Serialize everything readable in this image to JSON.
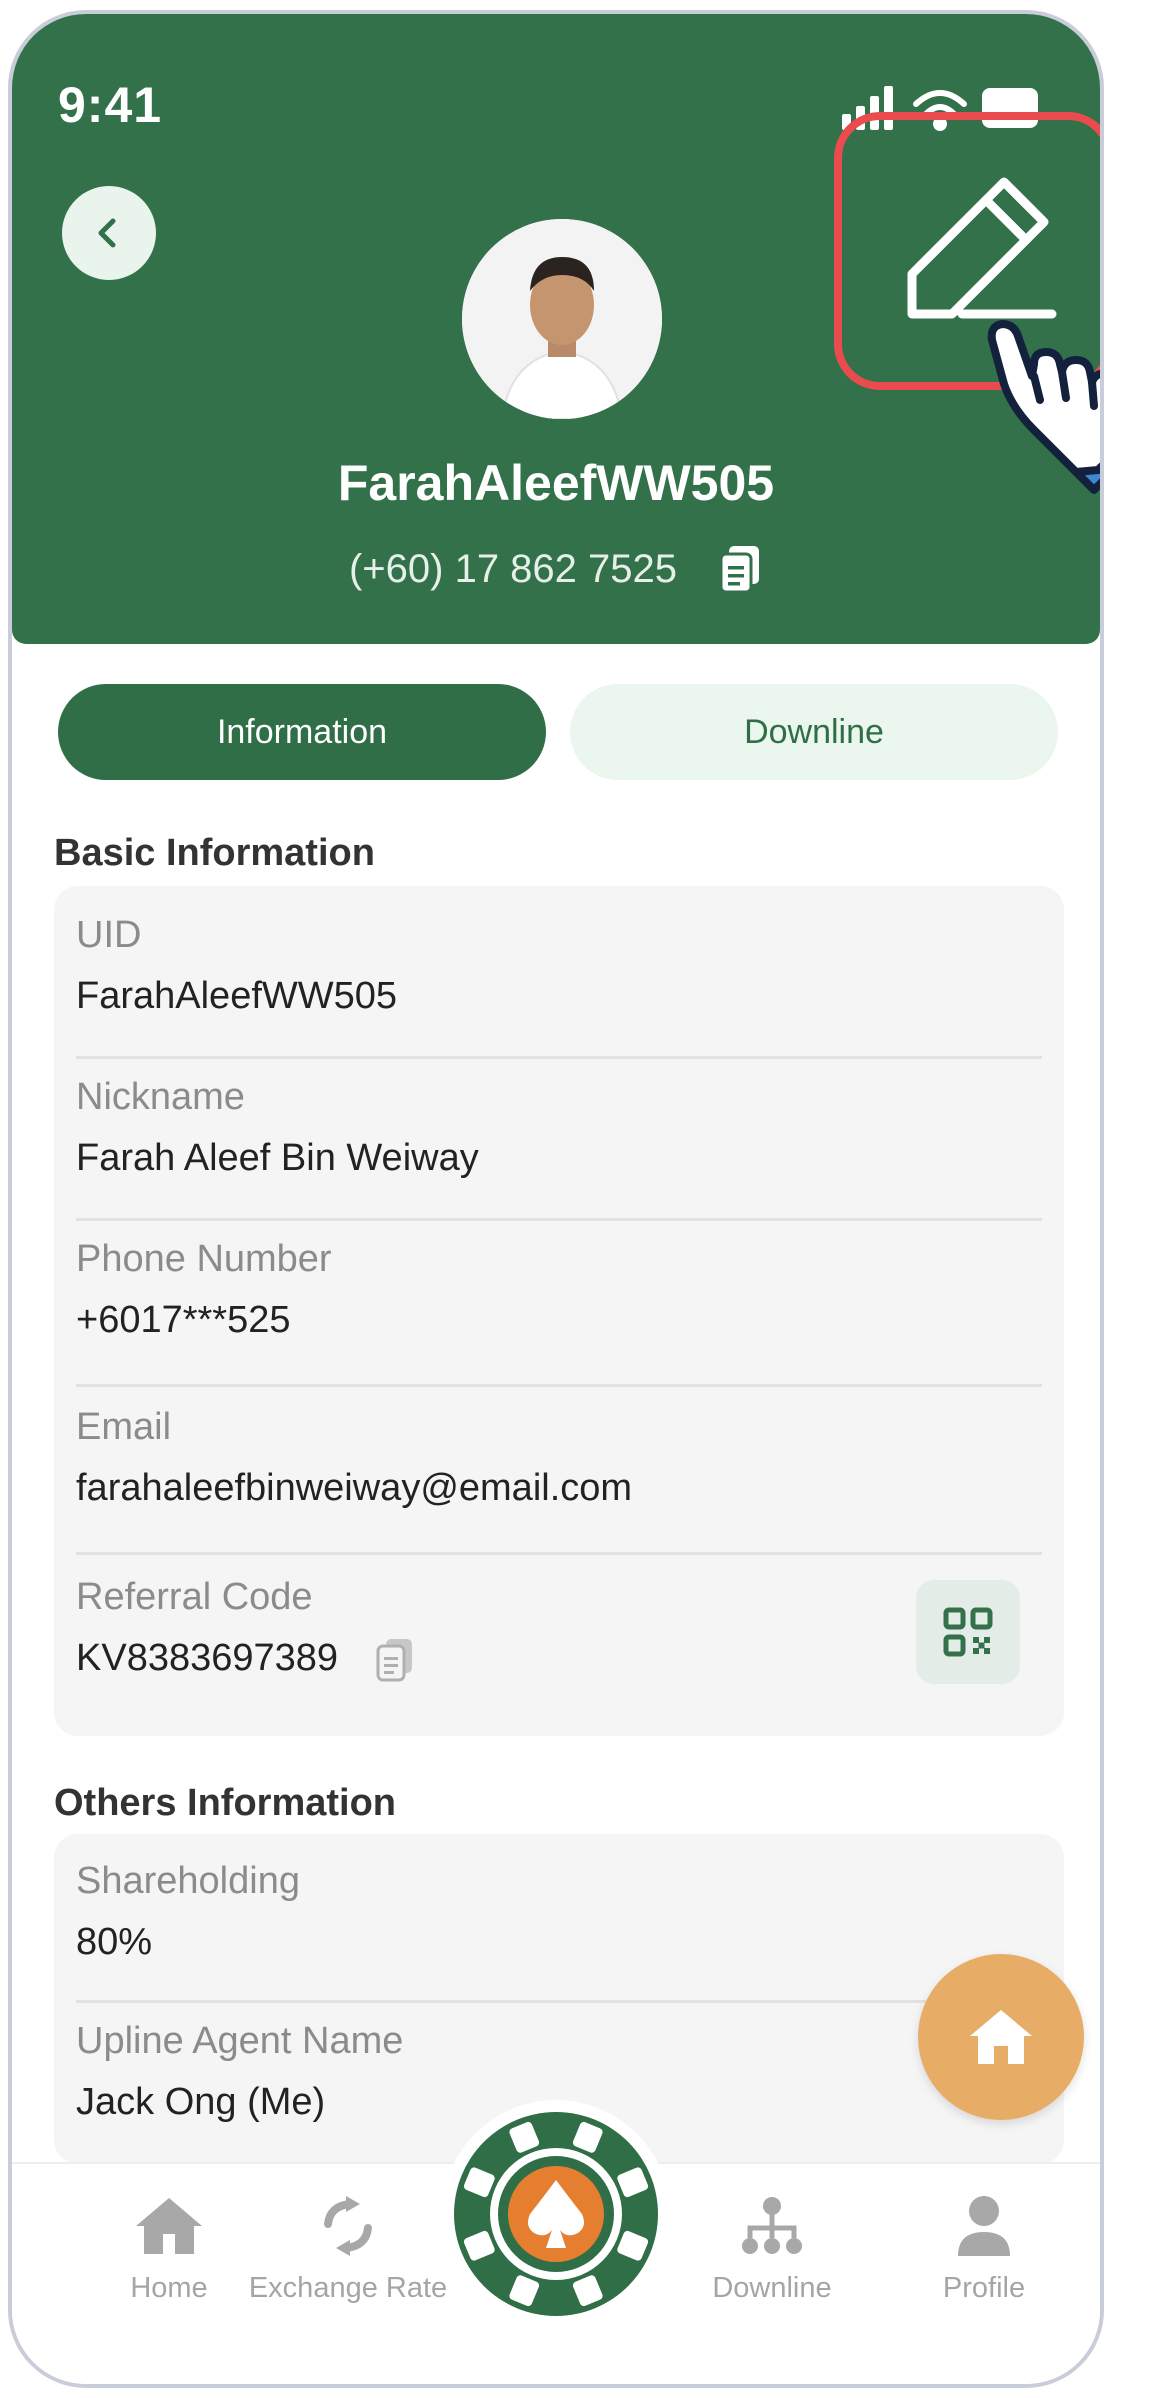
{
  "status_bar": {
    "time": "9:41"
  },
  "profile": {
    "username": "FarahAleefWW505",
    "phone": "(+60) 17 862 7525"
  },
  "tabs": [
    {
      "label": "Information",
      "active": true
    },
    {
      "label": "Downline",
      "active": false
    }
  ],
  "basic_info": {
    "title": "Basic Information",
    "fields": [
      {
        "label": "UID",
        "value": "FarahAleefWW505"
      },
      {
        "label": "Nickname",
        "value": "Farah Aleef Bin Weiway"
      },
      {
        "label": "Phone Number",
        "value": "+6017***525"
      },
      {
        "label": "Email",
        "value": "farahaleefbinweiway@email.com"
      },
      {
        "label": "Referral Code",
        "value": "KV8383697389"
      }
    ]
  },
  "others_info": {
    "title": "Others Information",
    "fields": [
      {
        "label": "Shareholding",
        "value": "80%"
      },
      {
        "label": "Upline Agent Name",
        "value": "Jack Ong (Me)"
      }
    ]
  },
  "bottom_nav": [
    {
      "label": "Home",
      "icon": "home-icon"
    },
    {
      "label": "Exchange Rate",
      "icon": "exchange-icon"
    },
    {
      "label": "",
      "icon": "poker-chip-icon"
    },
    {
      "label": "Downline",
      "icon": "hierarchy-icon"
    },
    {
      "label": "Profile",
      "icon": "person-icon"
    }
  ],
  "colors": {
    "primary_green": "#32714a",
    "light_green": "#ebf6ee",
    "highlight_red": "#ea4b4e",
    "fab_orange": "#e7ad66",
    "chip_orange": "#e67e30"
  }
}
